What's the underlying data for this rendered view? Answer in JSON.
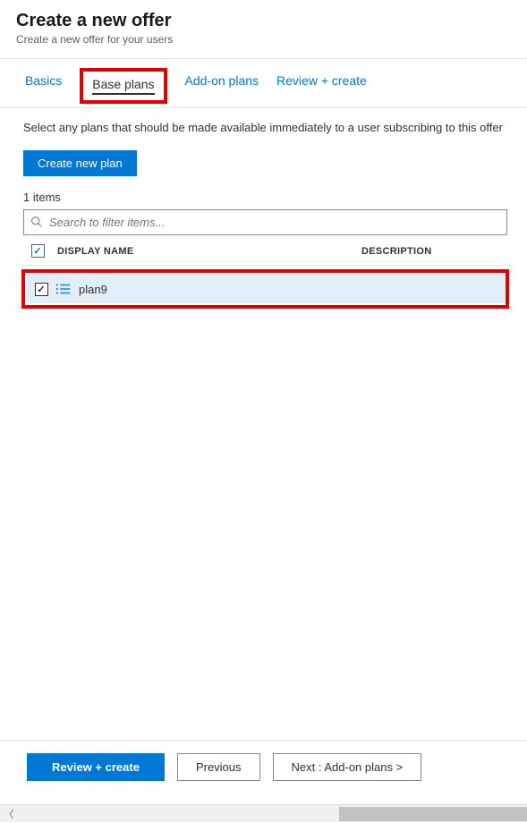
{
  "header": {
    "title": "Create a new offer",
    "subtitle": "Create a new offer for your users"
  },
  "tabs": {
    "basics": "Basics",
    "base_plans": "Base plans",
    "addon_plans": "Add-on plans",
    "review": "Review + create"
  },
  "instruction": "Select any plans that should be made available immediately to a user subscribing to this offer",
  "buttons": {
    "create_plan": "Create new plan",
    "review": "Review + create",
    "previous": "Previous",
    "next": "Next : Add-on plans >"
  },
  "list": {
    "count": "1 items",
    "search_placeholder": "Search to filter items...",
    "columns": {
      "name": "DISPLAY NAME",
      "desc": "DESCRIPTION"
    },
    "rows": [
      {
        "name": "plan9",
        "desc": "",
        "checked": true
      }
    ]
  }
}
